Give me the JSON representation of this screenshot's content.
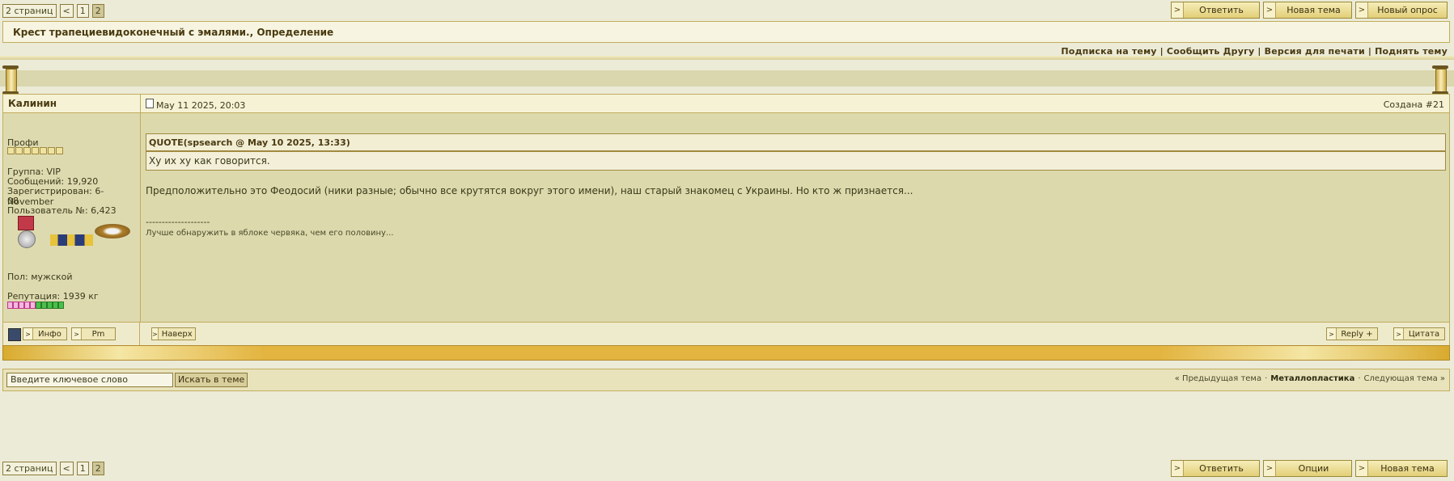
{
  "pager_top": {
    "label": "2 страниц",
    "prev": "<",
    "pages": [
      "1",
      "2"
    ]
  },
  "pager_bottom": {
    "label": "2 страниц",
    "prev": "<",
    "pages": [
      "1",
      "2"
    ]
  },
  "top_buttons": [
    "Ответить",
    "Новая тема",
    "Новый опрос"
  ],
  "bottom_buttons": [
    "Ответить",
    "Опции",
    "Новая тема"
  ],
  "topic_title": "Крест трапециевидоконечный с эмалями., Определение",
  "topic_options": "Подписка на тему | Сообщить Другу | Версия для печати | Поднять тему",
  "post": {
    "author": "Калинин",
    "date": "May 11 2025, 20:03",
    "post_num": "Создана #21",
    "rank": "Профи",
    "group": "Группа: VIP",
    "messages": "Сообщений: 19,920",
    "registered": "Зарегистрирован: 6-November",
    "registered_2": "08",
    "user_no": "Пользователь №: 6,423",
    "gender": "Пол: мужской",
    "reputation": "Репутация: 1939 кг",
    "quote_header": "QUOTE(spsearch @ May 10 2025, 13:33)",
    "quote_text": "Ху их ху как говорится.",
    "body": "Предположительно это Феодосий (ники разные; обычно все крутятся вокруг этого имени), наш старый знакомец с Украины. Но кто ж признается...",
    "sig_line": "--------------------",
    "signature": "Лучше обнаружить в яблоке червяка, чем его половину...",
    "btn_info": "Инфо",
    "btn_pm": "Pm",
    "btn_top": "Наверх",
    "btn_reply": "Reply +",
    "btn_quote": "Цитата"
  },
  "search": {
    "input_value": "Введите ключевое слово",
    "button": "Искать в теме"
  },
  "topic_nav": {
    "prev": "« Предыдущая тема",
    "forum": "Металлопластика",
    "next": "Следующая тема »",
    "sep": "·"
  },
  "colors": {
    "accent": "#e3b440",
    "background": "#ecebd8",
    "border": "#c2ad5e"
  }
}
